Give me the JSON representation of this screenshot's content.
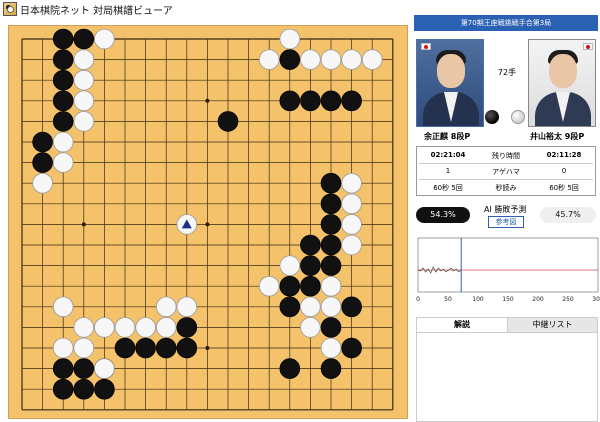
{
  "window": {
    "title": "日本棋院ネット 対局棋譜ビューア"
  },
  "event": {
    "title": "第70期王座戦挑戦手合第3局"
  },
  "move": {
    "label": "72手"
  },
  "players": {
    "black": {
      "name": "余正麒",
      "rank": "8段P"
    },
    "white": {
      "name": "井山裕太",
      "rank": "9段P"
    }
  },
  "info_table": {
    "time_black": "02:21:04",
    "time_label": "残り時間",
    "time_white": "02:11:28",
    "captures_black": "1",
    "captures_label": "アゲハマ",
    "captures_white": "0",
    "byoyomi_black": "60秒 5回",
    "byoyomi_label": "秒読み",
    "byoyomi_white": "60秒 5回"
  },
  "ai": {
    "title": "AI 勝敗予測",
    "ref_button": "参考図",
    "black_pct": "54.3%",
    "white_pct": "45.7%"
  },
  "graph": {
    "x_ticks": [
      "0",
      "50",
      "100",
      "150",
      "200",
      "250",
      "300"
    ],
    "x_max": 300,
    "current_move": 72
  },
  "tabs": {
    "commentary": "解説",
    "relay": "中継リスト"
  },
  "board_data": {
    "size": 19,
    "hoshi": [
      [
        3,
        3
      ],
      [
        3,
        9
      ],
      [
        3,
        15
      ],
      [
        9,
        3
      ],
      [
        9,
        9
      ],
      [
        9,
        15
      ],
      [
        15,
        3
      ],
      [
        15,
        9
      ],
      [
        15,
        15
      ]
    ],
    "black": [
      [
        2,
        0
      ],
      [
        3,
        0
      ],
      [
        2,
        1
      ],
      [
        2,
        2
      ],
      [
        2,
        3
      ],
      [
        2,
        4
      ],
      [
        1,
        5
      ],
      [
        1,
        6
      ],
      [
        10,
        4
      ],
      [
        13,
        1
      ],
      [
        13,
        3
      ],
      [
        14,
        3
      ],
      [
        15,
        3
      ],
      [
        16,
        3
      ],
      [
        15,
        7
      ],
      [
        15,
        8
      ],
      [
        15,
        9
      ],
      [
        15,
        10
      ],
      [
        15,
        11
      ],
      [
        14,
        10
      ],
      [
        14,
        11
      ],
      [
        14,
        12
      ],
      [
        13,
        12
      ],
      [
        13,
        13
      ],
      [
        16,
        13
      ],
      [
        15,
        14
      ],
      [
        16,
        15
      ],
      [
        8,
        14
      ],
      [
        8,
        15
      ],
      [
        7,
        15
      ],
      [
        6,
        15
      ],
      [
        5,
        15
      ],
      [
        4,
        16
      ],
      [
        3,
        16
      ],
      [
        2,
        16
      ],
      [
        2,
        17
      ],
      [
        3,
        17
      ],
      [
        4,
        17
      ],
      [
        13,
        16
      ],
      [
        15,
        16
      ]
    ],
    "white": [
      [
        4,
        0
      ],
      [
        2,
        5
      ],
      [
        3,
        1
      ],
      [
        3,
        2
      ],
      [
        3,
        3
      ],
      [
        3,
        4
      ],
      [
        2,
        6
      ],
      [
        1,
        7
      ],
      [
        13,
        0
      ],
      [
        12,
        1
      ],
      [
        14,
        1
      ],
      [
        15,
        1
      ],
      [
        16,
        1
      ],
      [
        17,
        1
      ],
      [
        16,
        7
      ],
      [
        16,
        8
      ],
      [
        16,
        9
      ],
      [
        16,
        10
      ],
      [
        15,
        12
      ],
      [
        14,
        13
      ],
      [
        15,
        13
      ],
      [
        14,
        14
      ],
      [
        15,
        15
      ],
      [
        12,
        12
      ],
      [
        13,
        11
      ],
      [
        8,
        13
      ],
      [
        7,
        14
      ],
      [
        6,
        14
      ],
      [
        5,
        14
      ],
      [
        4,
        14
      ],
      [
        3,
        14
      ],
      [
        3,
        15
      ],
      [
        2,
        15
      ],
      [
        4,
        16
      ],
      [
        2,
        13
      ],
      [
        7,
        13
      ]
    ],
    "last_move": [
      8,
      9
    ]
  }
}
